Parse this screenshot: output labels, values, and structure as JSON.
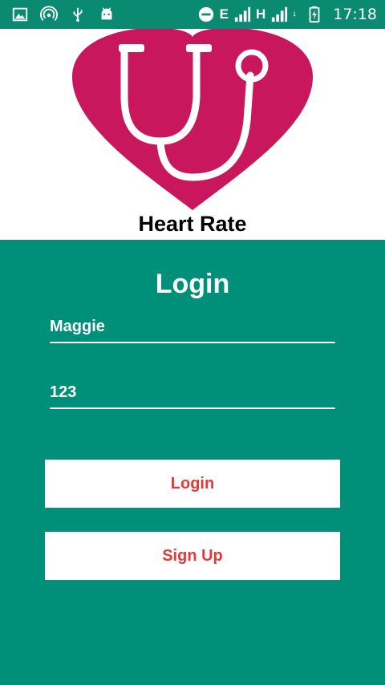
{
  "status_bar": {
    "network_1": "E",
    "network_2": "H",
    "time": "17:18"
  },
  "header": {
    "app_title": "Heart Rate"
  },
  "login": {
    "title": "Login",
    "username_value": "Maggie",
    "password_value": "123",
    "login_button": "Login",
    "signup_button": "Sign Up"
  },
  "colors": {
    "status_bar": "#0a8a70",
    "panel": "#008f78",
    "logo_heart": "#c8175d",
    "button_text": "#e53935"
  }
}
